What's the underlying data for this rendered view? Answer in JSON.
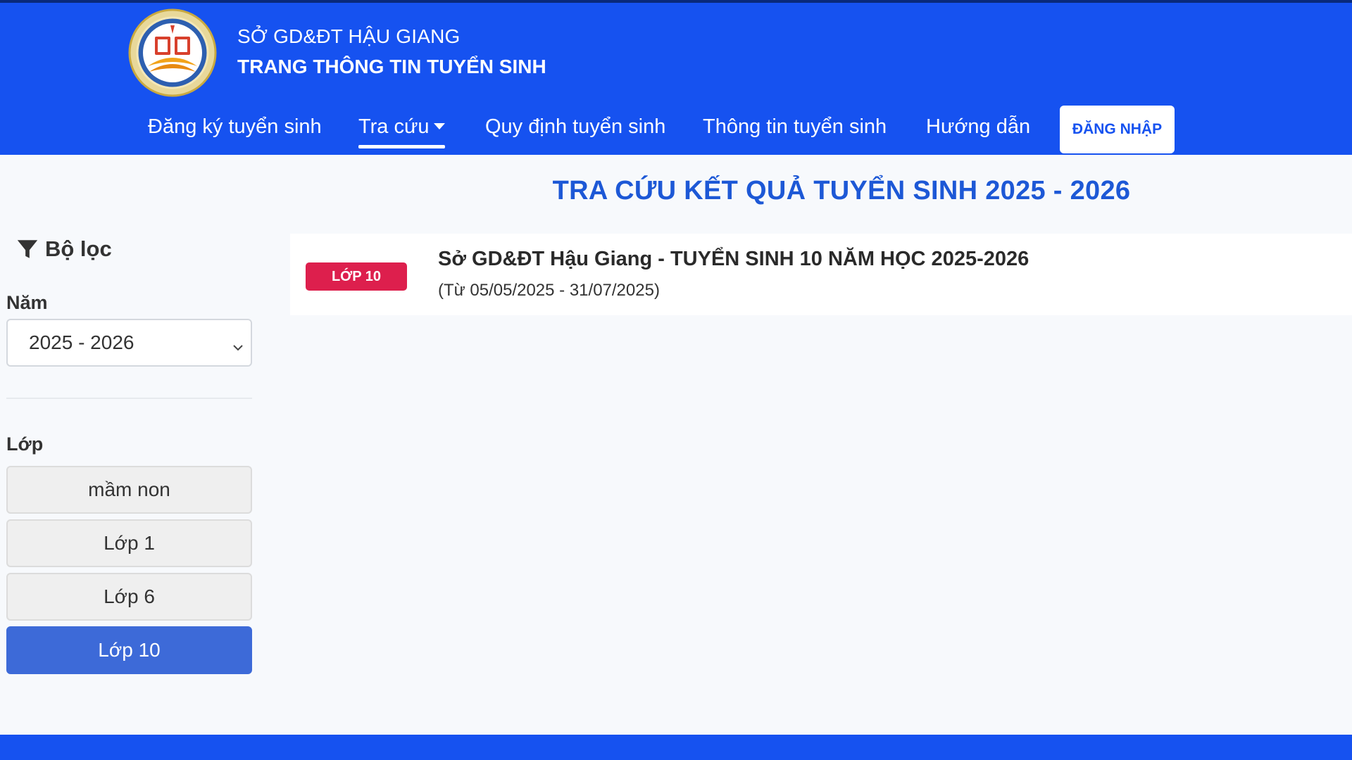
{
  "colors": {
    "header_bg": "#1652f0",
    "title_blue": "#1d58d6",
    "badge_red": "#dd1f4d",
    "selected_button": "#3d6ad8"
  },
  "header": {
    "org_name": "SỞ GD&ĐT HẬU GIANG",
    "site_name": "TRANG THÔNG TIN TUYỂN SINH",
    "nav": {
      "register": "Đăng ký tuyển sinh",
      "lookup": "Tra cứu",
      "regulations": "Quy định tuyển sinh",
      "info": "Thông tin tuyển sinh",
      "guide": "Hướng dẫn",
      "login": "ĐĂNG NHẬP"
    },
    "active_nav": "lookup"
  },
  "page": {
    "title": "TRA CỨU KẾT QUẢ TUYỂN SINH 2025 - 2026"
  },
  "sidebar": {
    "filter_label": "Bộ lọc",
    "year_label": "Năm",
    "year_selected": "2025 - 2026",
    "class_label": "Lớp",
    "classes": [
      "mầm non",
      "Lớp 1",
      "Lớp 6",
      "Lớp 10"
    ],
    "selected_class": "Lớp 10"
  },
  "results": [
    {
      "badge": "LỚP 10",
      "title": "Sở GD&ĐT Hậu Giang - TUYỂN SINH 10 NĂM HỌC 2025-2026",
      "date_range": "(Từ 05/05/2025 - 31/07/2025)"
    }
  ],
  "icons": {
    "filter": "filter-icon",
    "logo": "logo-icon",
    "dropdown": "chevron-down-icon",
    "nav_caret": "caret-down-icon"
  }
}
